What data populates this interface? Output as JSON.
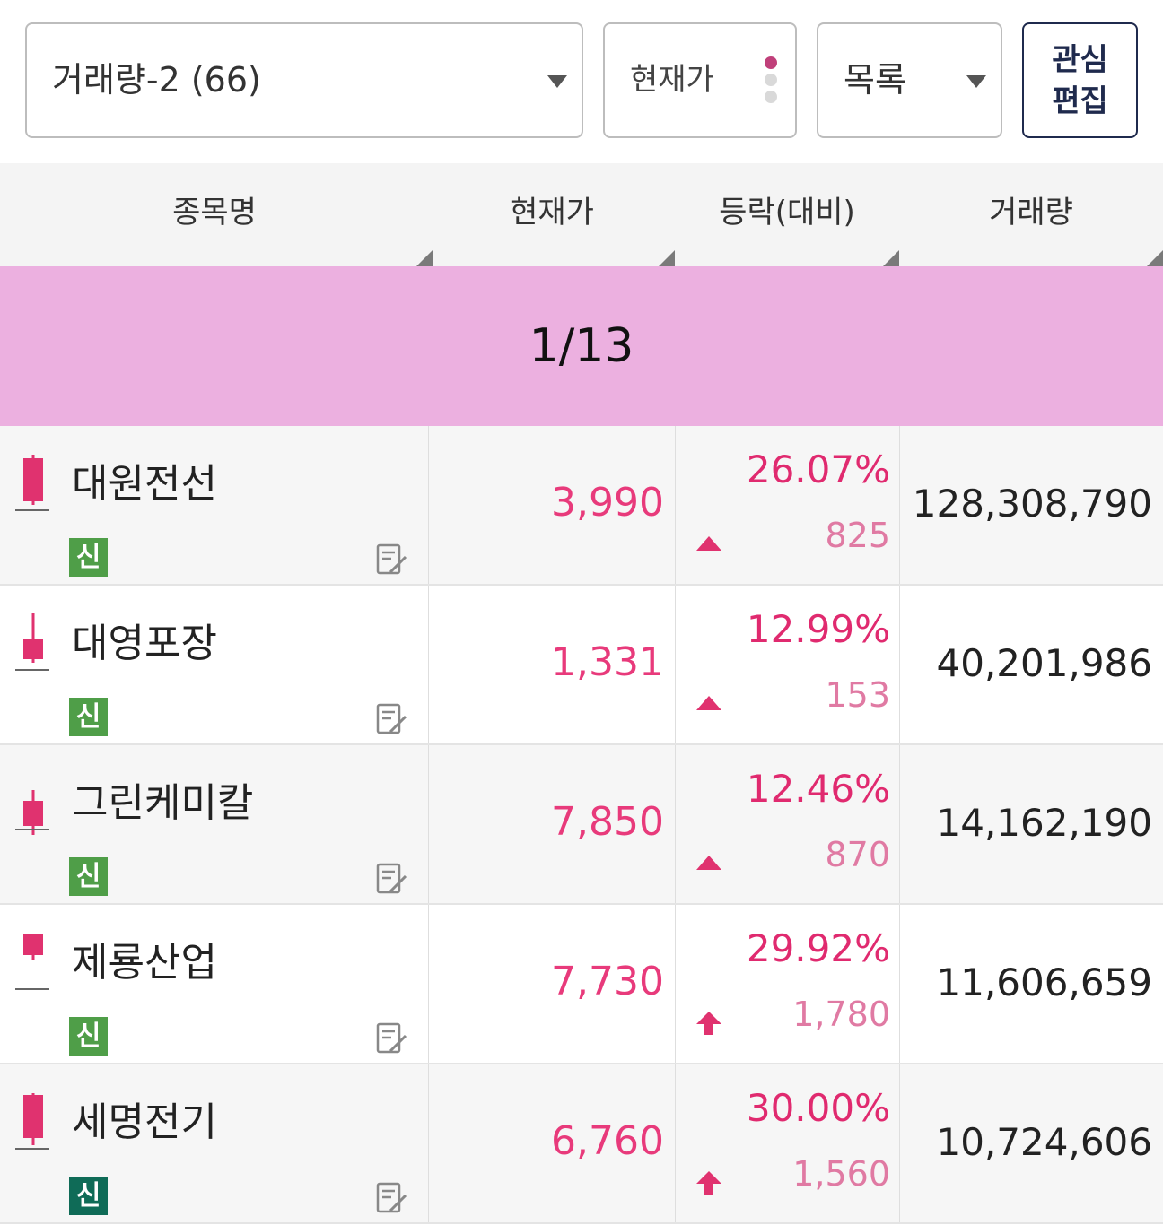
{
  "toolbar": {
    "group_label": "거래량-2 (66)",
    "price_toggle_label": "현재가",
    "view_label": "목록",
    "edit_label": "관심 편집"
  },
  "columns": {
    "name": "종목명",
    "price": "현재가",
    "change": "등락(대비)",
    "volume": "거래량"
  },
  "page_indicator": "1/13",
  "colors": {
    "up": "#e83a7b",
    "page_band": "#ecb0e0",
    "badge_green": "#4f9e48",
    "badge_teal": "#0f6b57"
  },
  "rows": [
    {
      "name": "대원전선",
      "badge": "신",
      "price": "3,990",
      "rate": "26.07%",
      "diff": "825",
      "volume": "128,308,790",
      "trend_icon": "up-triangle-icon",
      "candle": "tall-body"
    },
    {
      "name": "대영포장",
      "badge": "신",
      "price": "1,331",
      "rate": "12.99%",
      "diff": "153",
      "volume": "40,201,986",
      "trend_icon": "up-triangle-icon",
      "candle": "upper-wick"
    },
    {
      "name": "그린케미칼",
      "badge": "신",
      "price": "7,850",
      "rate": "12.46%",
      "diff": "870",
      "volume": "14,162,190",
      "trend_icon": "up-triangle-icon",
      "candle": "small-body"
    },
    {
      "name": "제룡산업",
      "badge": "신",
      "price": "7,730",
      "rate": "29.92%",
      "diff": "1,780",
      "volume": "11,606,659",
      "trend_icon": "limit-up-arrow-icon",
      "candle": "top-body"
    },
    {
      "name": "세명전기",
      "badge": "신",
      "price": "6,760",
      "rate": "30.00%",
      "diff": "1,560",
      "volume": "10,724,606",
      "trend_icon": "limit-up-arrow-icon",
      "candle": "tall-body"
    }
  ]
}
